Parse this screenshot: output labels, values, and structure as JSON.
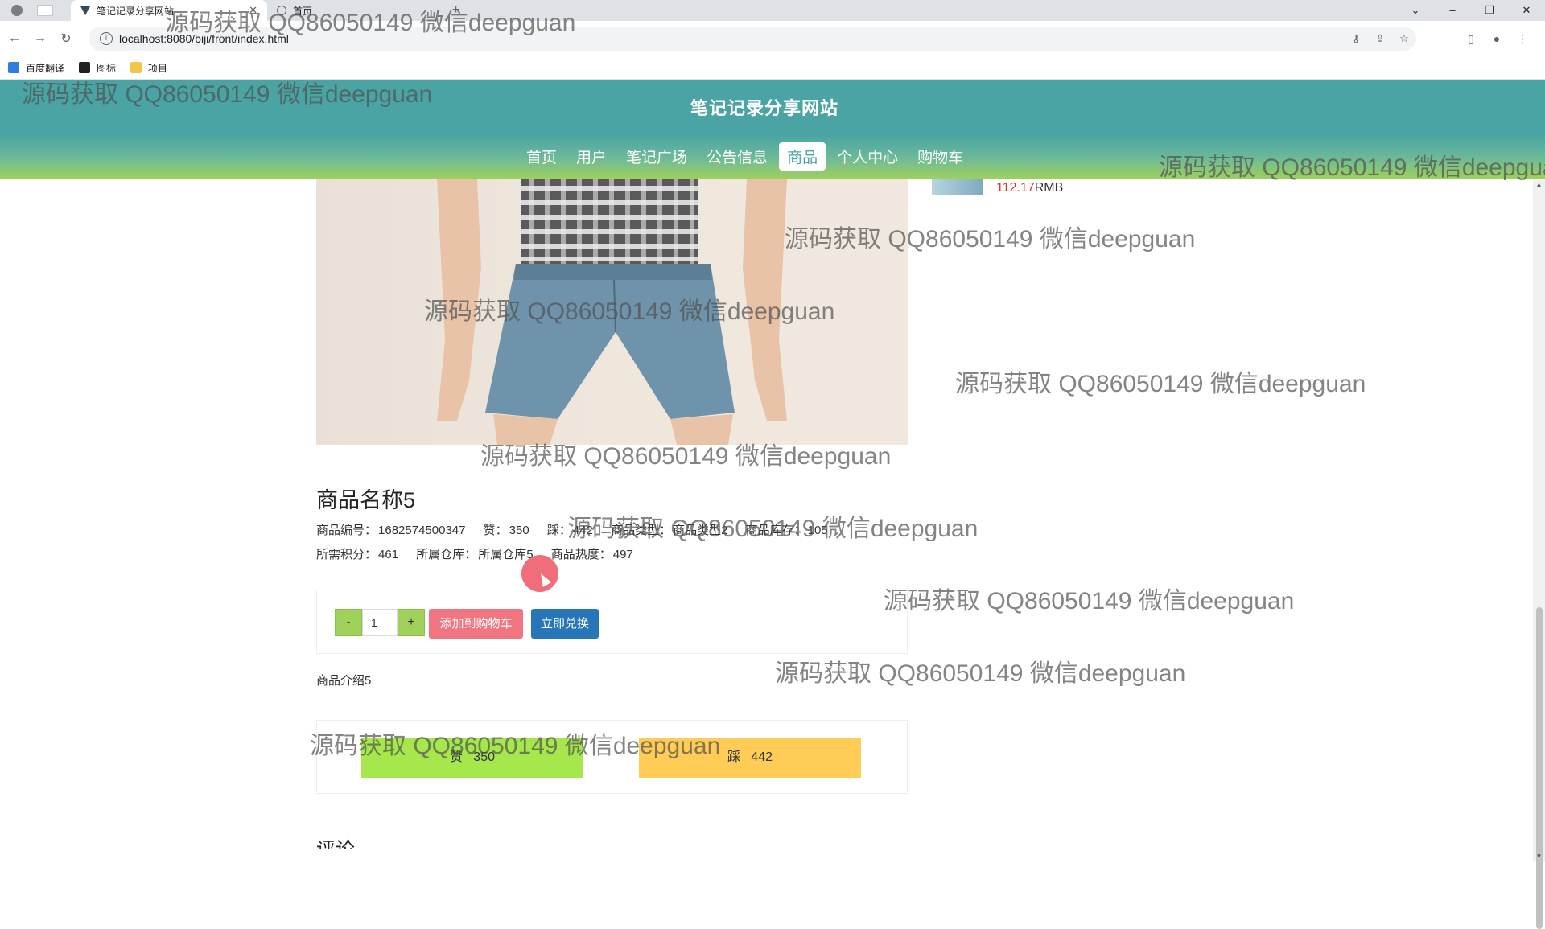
{
  "browser": {
    "active_tab_title": "笔记记录分享网站",
    "inactive_tab_title": "首页",
    "url": "localhost:8080/biji/front/index.html",
    "bookmarks": [
      "百度翻译",
      "图标",
      "项目"
    ]
  },
  "site": {
    "title": "笔记记录分享网站",
    "nav": [
      "首页",
      "用户",
      "笔记广场",
      "公告信息",
      "商品",
      "个人中心",
      "购物车"
    ],
    "active_nav": "商品"
  },
  "sidebar": {
    "price_value": "112.17",
    "price_unit": "RMB"
  },
  "product": {
    "name": "商品名称5",
    "row1": {
      "code_label": "商品编号：",
      "code": "1682574500347",
      "like_label": "赞：",
      "likes": "350",
      "dislike_label": "踩：",
      "dislikes": "442",
      "type_label": "商品类型：",
      "type": "商品类型2",
      "stock_label": "商品库存：",
      "stock": "105"
    },
    "row2": {
      "points_label": "所需积分：",
      "points": "461",
      "warehouse_label": "所属仓库：",
      "warehouse": "所属仓库5",
      "heat_label": "商品热度：",
      "heat": "497"
    },
    "quantity": "1",
    "minus": "-",
    "plus": "+",
    "add_cart": "添加到购物车",
    "redeem": "立即兑换",
    "intro": "商品介绍5",
    "like_button": "赞   350",
    "dislike_button": "踩   442",
    "comments_heading": "评论"
  },
  "watermark_text": "源码获取 QQ86050149 微信deepguan",
  "colors": {
    "header_teal": "#4aa4a4",
    "header_green": "#9fd15b",
    "cart_button": "#ef7680",
    "redeem_button": "#2776b7",
    "like_bar": "#a6e74c",
    "dislike_bar": "#ffcc55",
    "price_red": "#e03030"
  }
}
